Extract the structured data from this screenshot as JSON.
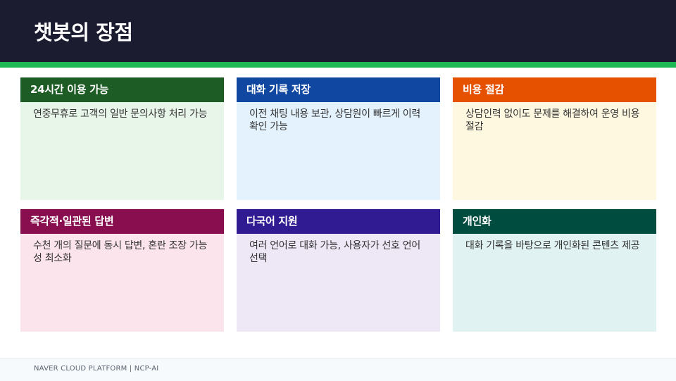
{
  "header": {
    "title": "챗봇의 장점"
  },
  "colors": {
    "header_bg": "#1c1c30",
    "accent": "#1db954"
  },
  "cards": [
    {
      "title": "24시간 이용 가능",
      "body": "연중무휴로 고객의 일반 문의사항 처리 가능",
      "head_color": "#1e5c25",
      "body_color": "#e8f5e9"
    },
    {
      "title": "대화 기록 저장",
      "body": "이전 채팅 내용 보관, 상담원이 빠르게 이력 확인 가능",
      "head_color": "#0f47a1",
      "body_color": "#e3f2fd"
    },
    {
      "title": "비용 절감",
      "body": "상담인력 없이도 문제를 해결하여 운영 비용 절감",
      "head_color": "#e65100",
      "body_color": "#fff8e1"
    },
    {
      "title": "즉각적·일관된 답변",
      "body": "수천 개의 질문에 동시 답변, 혼란 조장 가능성 최소화",
      "head_color": "#880e4f",
      "body_color": "#fce4ec"
    },
    {
      "title": "다국어 지원",
      "body": "여러 언어로 대화 가능, 사용자가 선호 언어 선택",
      "head_color": "#311b92",
      "body_color": "#ede7f6"
    },
    {
      "title": "개인화",
      "body": "대화 기록을 바탕으로 개인화된 콘텐츠 제공",
      "head_color": "#004d40",
      "body_color": "#e0f2f1"
    }
  ],
  "footer": {
    "text": "NAVER CLOUD PLATFORM  |  NCP-AI"
  }
}
